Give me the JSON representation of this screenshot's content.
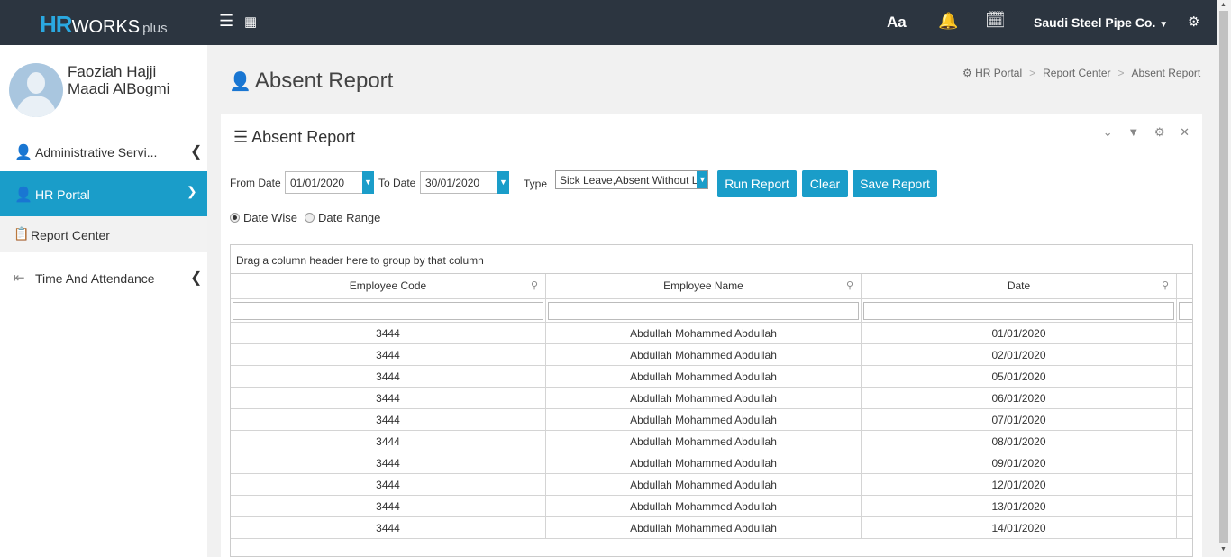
{
  "header": {
    "logo_hr": "HR",
    "logo_works": "WORKS",
    "logo_plus": "plus",
    "font_icon": "Aa",
    "company": "Saudi Steel Pipe Co."
  },
  "user": {
    "name_line1": "Faoziah Hajji",
    "name_line2": "Maadi AlBogmi"
  },
  "sidebar": {
    "items": [
      {
        "label": "Administrative Servi...",
        "icon": "user-icon"
      },
      {
        "label": "HR Portal",
        "icon": "user-tie-icon"
      },
      {
        "label": "Report Center",
        "icon": "report-icon"
      },
      {
        "label": "Time And Attendance",
        "icon": "sign-in-icon"
      }
    ]
  },
  "page": {
    "title": "Absent Report"
  },
  "breadcrumb": [
    "HR Portal",
    "Report Center",
    "Absent Report"
  ],
  "panel": {
    "title": "Absent Report"
  },
  "filters": {
    "from_label": "From Date",
    "from_value": "01/01/2020",
    "to_label": "To Date",
    "to_value": "30/01/2020",
    "type_label": "Type",
    "type_value": "Sick Leave,Absent Without L",
    "run_label": "Run Report",
    "clear_label": "Clear",
    "save_label": "Save Report",
    "radio_date_wise": "Date Wise",
    "radio_date_range": "Date Range"
  },
  "grid": {
    "group_text": "Drag a column header here to group by that column",
    "columns": [
      "Employee Code",
      "Employee Name",
      "Date"
    ],
    "rows": [
      [
        "3444",
        "Abdullah Mohammed Abdullah",
        "01/01/2020"
      ],
      [
        "3444",
        "Abdullah Mohammed Abdullah",
        "02/01/2020"
      ],
      [
        "3444",
        "Abdullah Mohammed Abdullah",
        "05/01/2020"
      ],
      [
        "3444",
        "Abdullah Mohammed Abdullah",
        "06/01/2020"
      ],
      [
        "3444",
        "Abdullah Mohammed Abdullah",
        "07/01/2020"
      ],
      [
        "3444",
        "Abdullah Mohammed Abdullah",
        "08/01/2020"
      ],
      [
        "3444",
        "Abdullah Mohammed Abdullah",
        "09/01/2020"
      ],
      [
        "3444",
        "Abdullah Mohammed Abdullah",
        "12/01/2020"
      ],
      [
        "3444",
        "Abdullah Mohammed Abdullah",
        "13/01/2020"
      ],
      [
        "3444",
        "Abdullah Mohammed Abdullah",
        "14/01/2020"
      ]
    ]
  },
  "colors": {
    "topbar": "#2c3540",
    "accent": "#1a9dc9",
    "logo_hr": "#2aa8e0"
  }
}
